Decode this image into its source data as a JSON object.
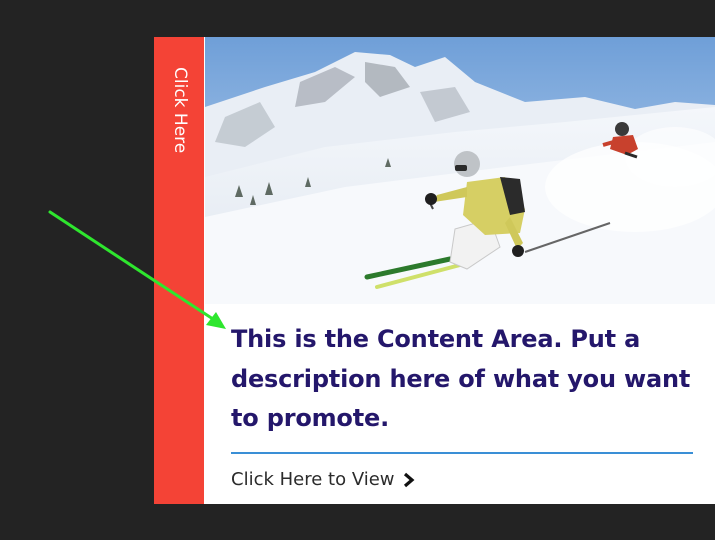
{
  "side_tab": {
    "label": "Click Here"
  },
  "content": {
    "title": "This is the Content Area. Put a description here of what you want to promote.",
    "link_label": "Click Here to View"
  },
  "icons": {
    "link_icon": "chevron-right-icon",
    "annotation": "green-arrow-icon"
  },
  "colors": {
    "background": "#232323",
    "side_tab": "#f44336",
    "title_text": "#24176b",
    "divider": "#3a8fd6",
    "annotation_arrow": "#2ee62e"
  }
}
